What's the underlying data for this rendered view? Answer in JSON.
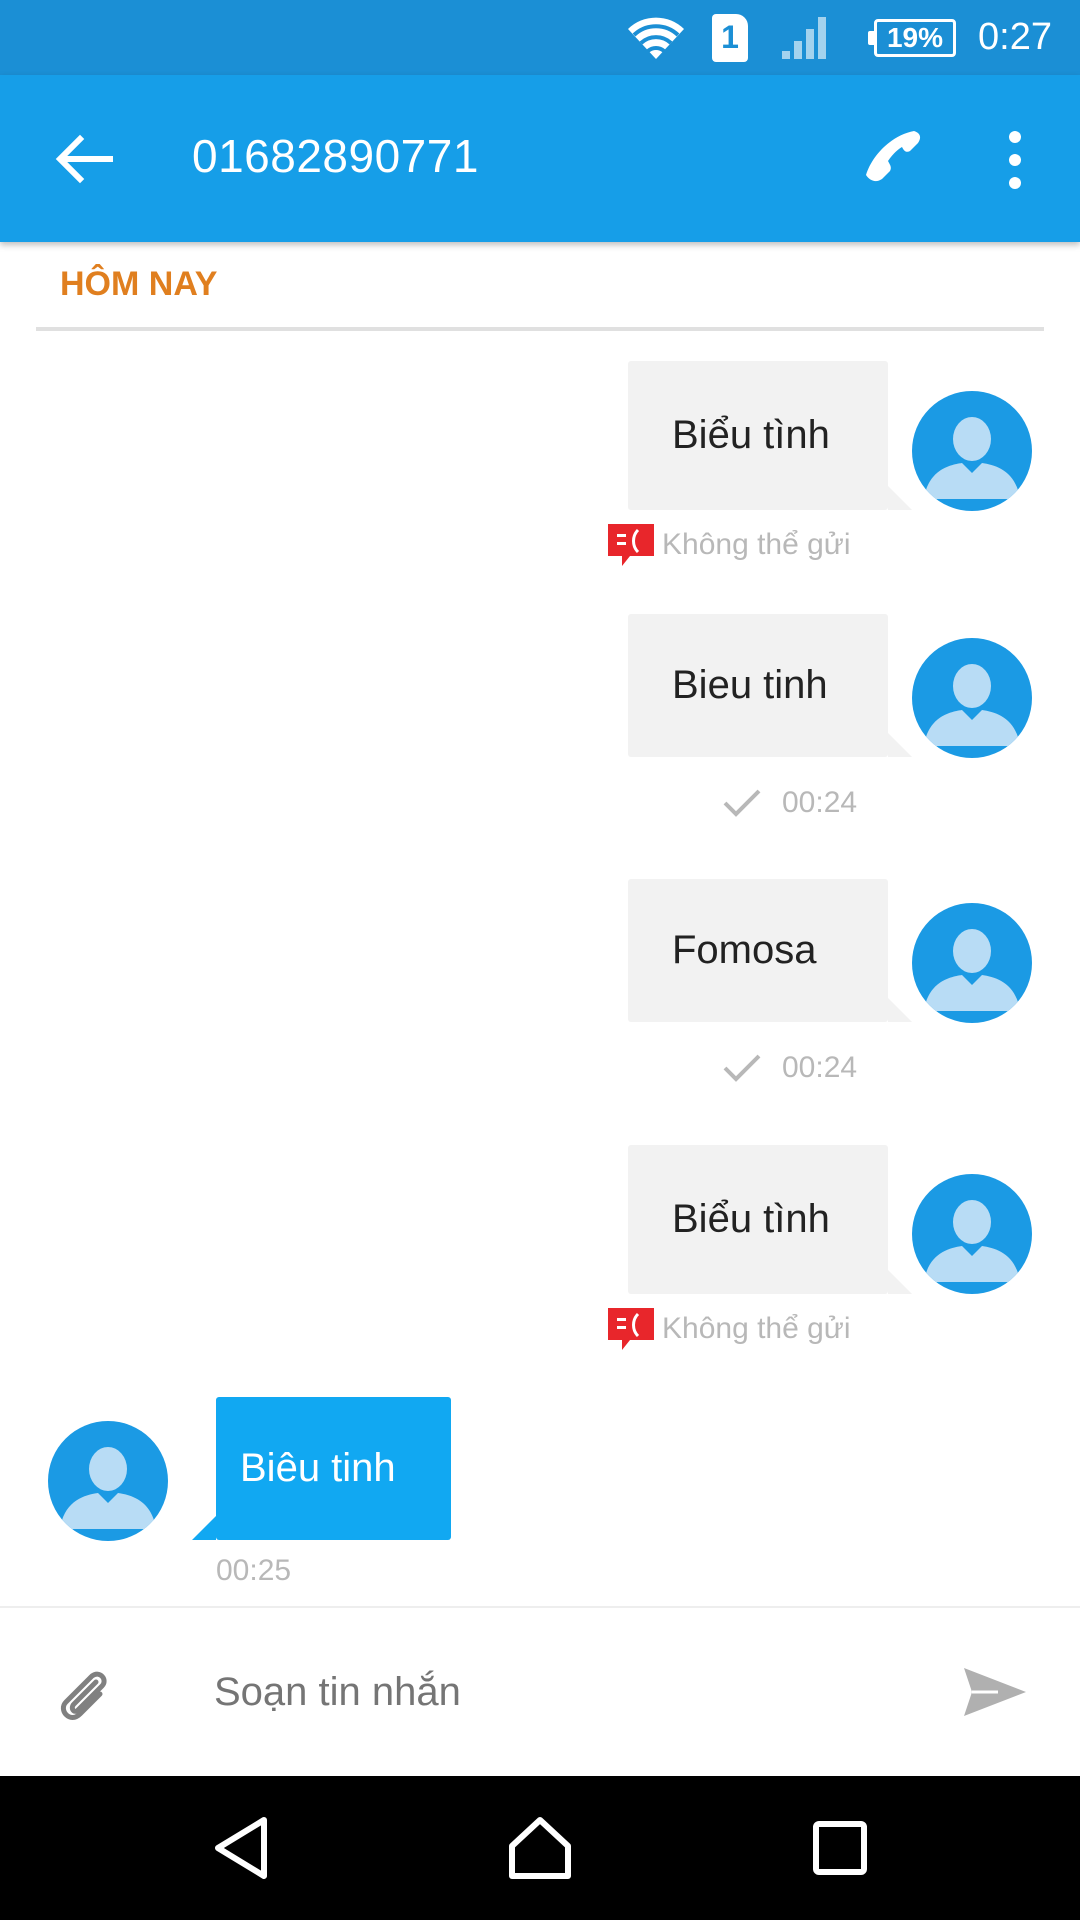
{
  "status_bar": {
    "sim_slot": "1",
    "battery": "19%",
    "time": "0:27",
    "icons": [
      "wifi-icon",
      "sim-icon",
      "signal-icon",
      "battery-icon"
    ]
  },
  "app_bar": {
    "title": "01682890771",
    "back_icon": "arrow-left-icon",
    "call_icon": "phone-icon",
    "more_icon": "more-vert-icon"
  },
  "conversation": {
    "date_header": "HÔM NAY",
    "messages": [
      {
        "direction": "outgoing",
        "text": "Biểu tình",
        "status": "failed",
        "meta": "Không thể gửi"
      },
      {
        "direction": "outgoing",
        "text": "Bieu tinh",
        "status": "sent",
        "meta": "00:24"
      },
      {
        "direction": "outgoing",
        "text": "Fomosa",
        "status": "sent",
        "meta": "00:24"
      },
      {
        "direction": "outgoing",
        "text": "Biểu tình",
        "status": "failed",
        "meta": "Không thể gửi"
      },
      {
        "direction": "incoming",
        "text": "Biêu tinh",
        "meta": "00:25"
      }
    ]
  },
  "composer": {
    "placeholder": "Soạn tin nhắn",
    "value": "",
    "attach_icon": "paperclip-icon",
    "send_icon": "send-icon"
  },
  "nav_bar": {
    "icons": [
      "back-triangle-icon",
      "home-icon",
      "recents-square-icon"
    ]
  },
  "colors": {
    "status_bar": "#1b8fd5",
    "app_bar": "#169ee8",
    "date_header": "#e07f1f",
    "outgoing_bubble": "#f2f2f2",
    "incoming_bubble": "#11a8f2",
    "error": "#e8262b"
  }
}
